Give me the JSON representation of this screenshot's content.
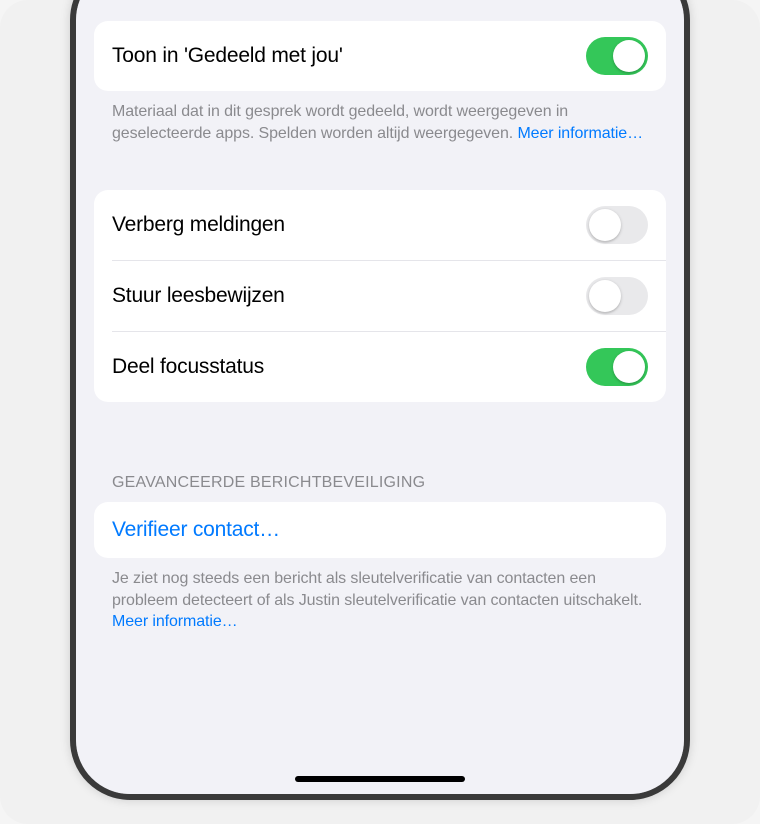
{
  "section1": {
    "show_shared_label": "Toon in 'Gedeeld met jou'",
    "show_shared_on": true,
    "footer_text": "Materiaal dat in dit gesprek wordt gedeeld, wordt weergegeven in geselecteerde apps. Spelden worden altijd weergegeven. ",
    "footer_link": "Meer informatie…"
  },
  "section2": {
    "hide_alerts_label": "Verberg meldingen",
    "hide_alerts_on": false,
    "read_receipts_label": "Stuur leesbewijzen",
    "read_receipts_on": false,
    "focus_status_label": "Deel focusstatus",
    "focus_status_on": true
  },
  "section3": {
    "header": "GEAVANCEERDE BERICHTBEVEILIGING",
    "verify_label": "Verifieer contact…",
    "footer_text": "Je ziet nog steeds een bericht als sleutelverificatie van contacten een probleem detecteert of als Justin sleutelverificatie van contacten uitschakelt. ",
    "footer_link": "Meer informatie…"
  }
}
